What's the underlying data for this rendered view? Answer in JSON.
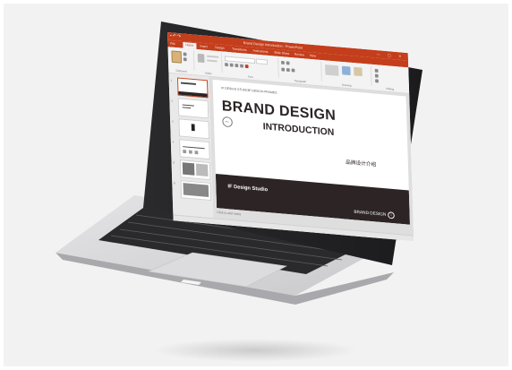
{
  "app": {
    "window_title": "Brand Design Introduction - PowerPoint",
    "tabs": [
      "File",
      "Home",
      "Insert",
      "Design",
      "Transitions",
      "Animations",
      "Slide Show",
      "Review",
      "View"
    ],
    "active_tab": "Home",
    "ribbon_groups": [
      "Clipboard",
      "Slides",
      "Font",
      "Paragraph",
      "Drawing",
      "Editing"
    ],
    "accent_color": "#c43e1c"
  },
  "thumbnails": {
    "count": 6,
    "selected_index": 1
  },
  "slide": {
    "top_note_left": "IF DESIGN STUDIO",
    "top_note_right": "IF DESIGN FRAMES",
    "title": "BRAND DESIGN",
    "subtitle": "INTRODUCTION",
    "chinese_title": "品牌设计介绍",
    "studio": "IF Design Studio",
    "footer_label": "BRAND DESIGN",
    "footer_icon": "info-circle-icon",
    "back_icon": "arrow-left-icon",
    "bar_color": "#2d2525"
  },
  "notes_placeholder": "Click to add notes"
}
